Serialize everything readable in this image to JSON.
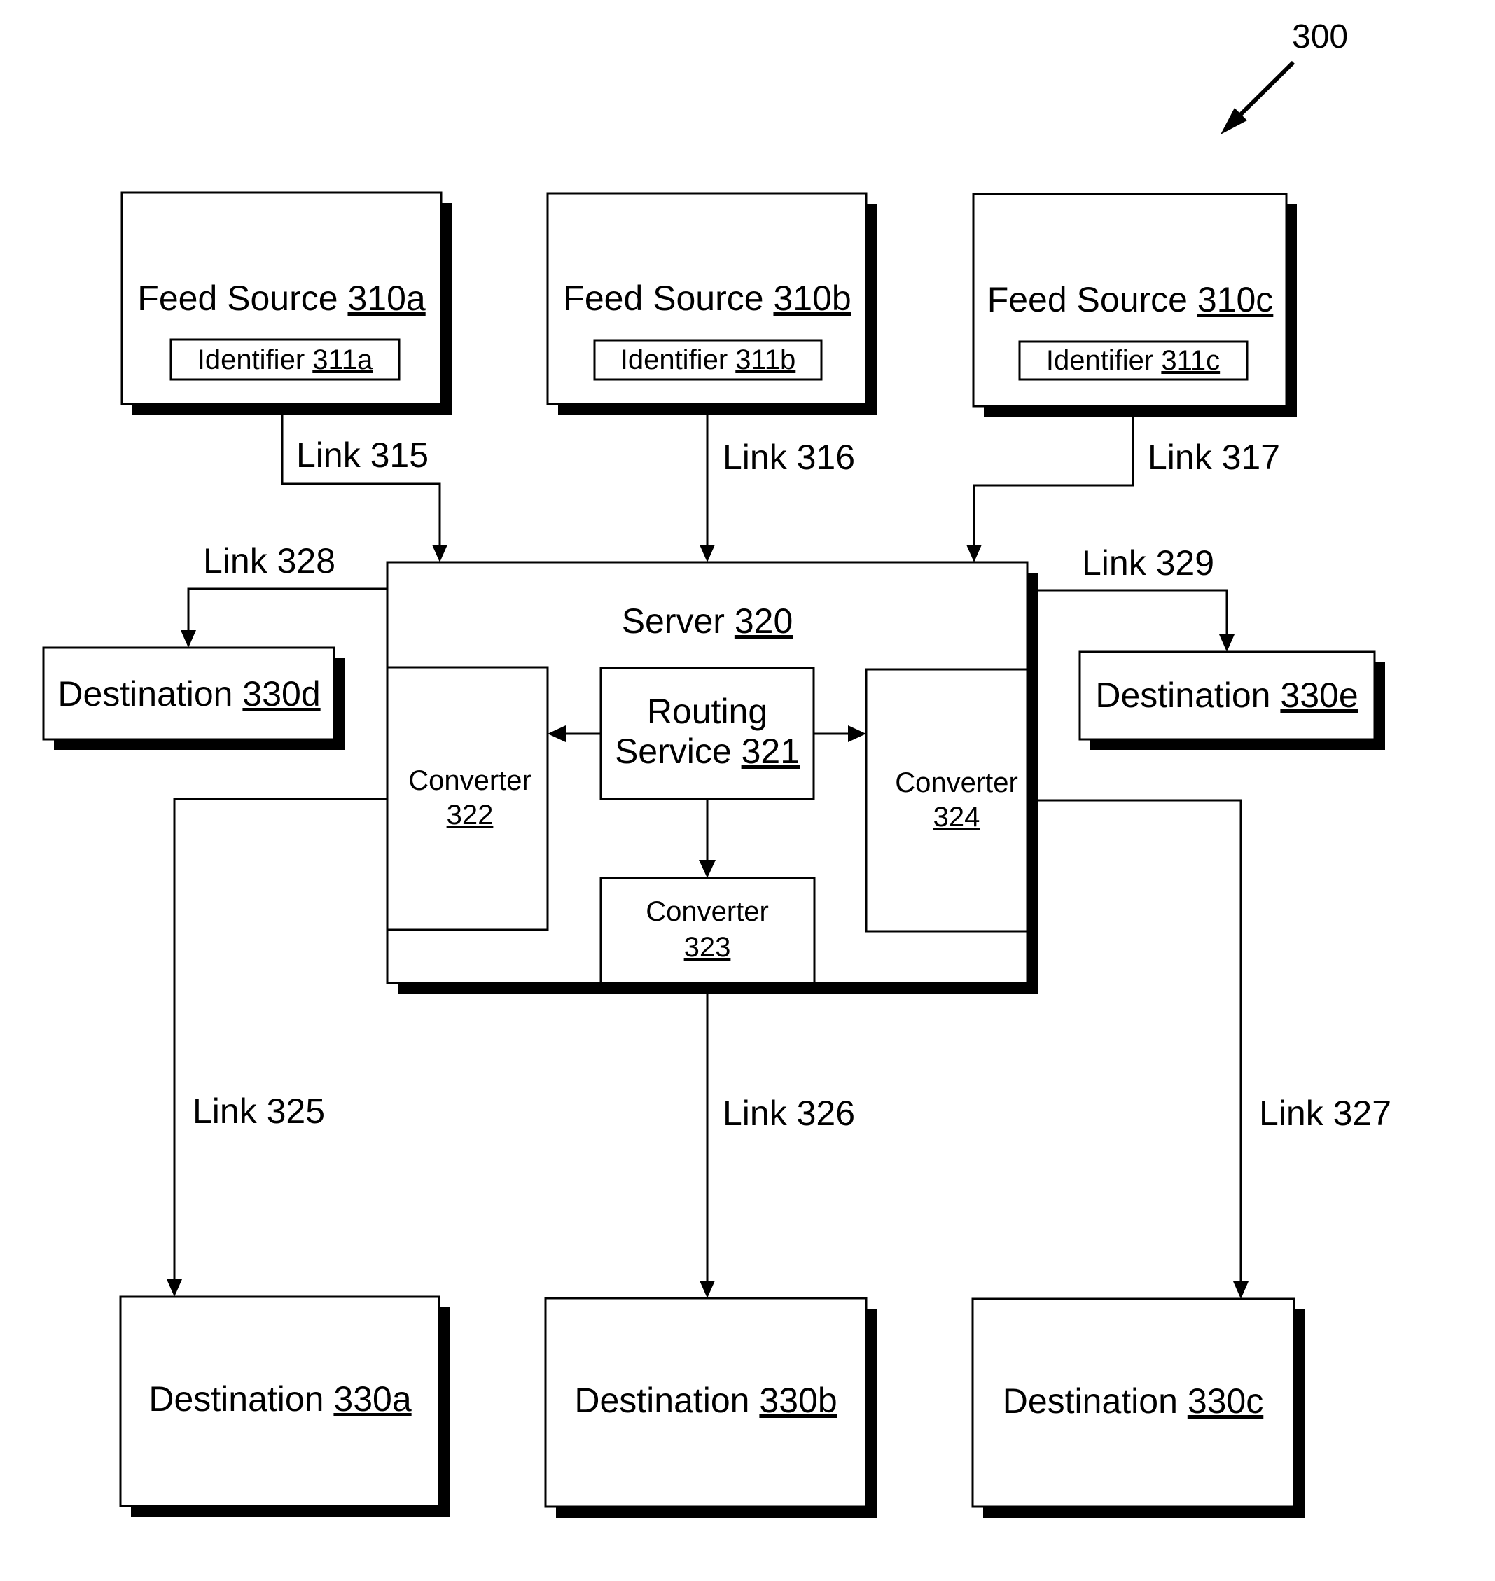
{
  "figure_ref": "300",
  "feed_sources": [
    {
      "name": "Feed Source",
      "ref": "310a",
      "identifier": {
        "name": "Identifier",
        "ref": "311a"
      }
    },
    {
      "name": "Feed Source",
      "ref": "310b",
      "identifier": {
        "name": "Identifier",
        "ref": "311b"
      }
    },
    {
      "name": "Feed Source",
      "ref": "310c",
      "identifier": {
        "name": "Identifier",
        "ref": "311c"
      }
    }
  ],
  "server": {
    "name": "Server",
    "ref": "320",
    "routing": {
      "line1": "Routing",
      "line2": "Service",
      "ref": "321"
    },
    "converters": [
      {
        "name": "Converter",
        "ref": "322"
      },
      {
        "name": "Converter",
        "ref": "323"
      },
      {
        "name": "Converter",
        "ref": "324"
      }
    ]
  },
  "destinations": [
    {
      "name": "Destination",
      "ref": "330a"
    },
    {
      "name": "Destination",
      "ref": "330b"
    },
    {
      "name": "Destination",
      "ref": "330c"
    },
    {
      "name": "Destination",
      "ref": "330d"
    },
    {
      "name": "Destination",
      "ref": "330e"
    }
  ],
  "links": {
    "l315": "Link 315",
    "l316": "Link 316",
    "l317": "Link 317",
    "l325": "Link 325",
    "l326": "Link 326",
    "l327": "Link 327",
    "l328": "Link 328",
    "l329": "Link 329"
  }
}
